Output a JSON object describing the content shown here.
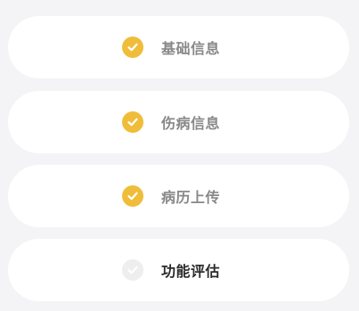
{
  "colors": {
    "page_background": "#f4f4f6",
    "card_background": "#ffffff",
    "completed_check": "#f0bd3a",
    "pending_check": "#eeeeee",
    "completed_label": "#888888",
    "current_label": "#2b2b2b"
  },
  "steps": [
    {
      "label": "基础信息",
      "status": "completed",
      "icon": "check-circle-icon"
    },
    {
      "label": "伤病信息",
      "status": "completed",
      "icon": "check-circle-icon"
    },
    {
      "label": "病历上传",
      "status": "completed",
      "icon": "check-circle-icon"
    },
    {
      "label": "功能评估",
      "status": "current",
      "icon": "check-circle-icon"
    }
  ]
}
